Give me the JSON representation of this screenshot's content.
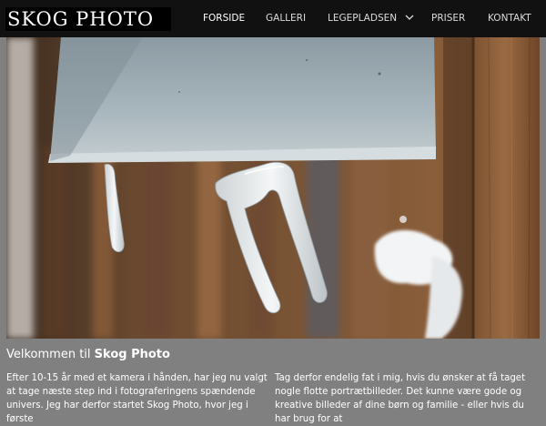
{
  "header": {
    "logo": "SKOG PHOTO",
    "nav": [
      {
        "label": "FORSIDE",
        "active": true
      },
      {
        "label": "GALLERI"
      },
      {
        "label": "LEGEPLADSEN",
        "has_dropdown": true
      },
      {
        "label": "PRISER"
      },
      {
        "label": "KONTAKT"
      }
    ]
  },
  "hero": {
    "image": "icicles-on-lamp-photo"
  },
  "content": {
    "welcome_prefix": "Velkommen til ",
    "welcome_brand": "Skog Photo",
    "left_text": "Efter 10-15 år med et kamera i hånden, har jeg nu valgt at tage næste step ind i fotograferingens spændende univers. Jeg har derfor startet Skog Photo, hvor jeg i første",
    "right_text": "Tag derfor endelig fat i mig, hvis du ønsker at få taget nogle flotte portrætbilleder. Det kunne være gode og kreative billeder af dine børn og familie - eller hvis du har brug for at"
  },
  "colors": {
    "header_bg": "#111111",
    "page_bg": "#808080",
    "text": "#ffffff"
  }
}
